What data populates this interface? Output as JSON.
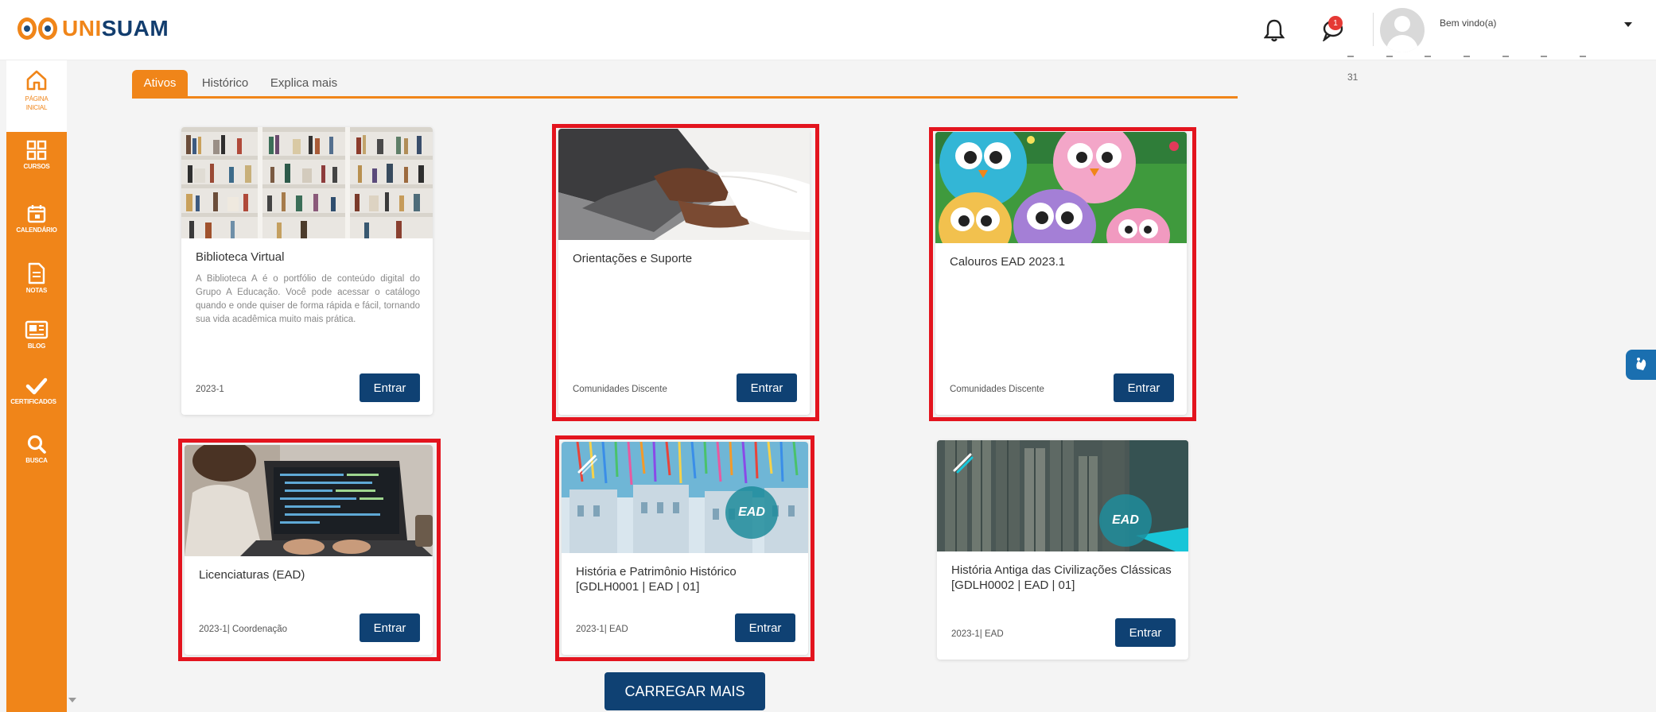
{
  "header": {
    "logo_prefix": "UNI",
    "logo_suffix": "SUAM",
    "notification_count": "1",
    "welcome_text": "Bem vindo(a)"
  },
  "sidebar": {
    "items": [
      {
        "label": "PÁGINA INICIAL",
        "icon": "home-icon"
      },
      {
        "label": "CURSOS",
        "icon": "grid-icon"
      },
      {
        "label": "CALENDÁRIO",
        "icon": "calendar-icon"
      },
      {
        "label": "NOTAS",
        "icon": "document-icon"
      },
      {
        "label": "BLOG",
        "icon": "newspaper-icon"
      },
      {
        "label": "CERTIFICADOS",
        "icon": "check-icon"
      },
      {
        "label": "BUSCA",
        "icon": "search-icon"
      }
    ]
  },
  "tabs": [
    {
      "label": "Ativos",
      "active": true
    },
    {
      "label": "Histórico",
      "active": false
    },
    {
      "label": "Explica mais",
      "active": false
    }
  ],
  "cards": [
    {
      "title": "Biblioteca Virtual",
      "description": "A Biblioteca A é o portfólio de conteúdo digital do Grupo A Educação. Você pode acessar o catálogo quando e onde quiser de forma rápida e fácil, tornando sua vida acadêmica muito mais prática.",
      "meta": "2023-1",
      "button": "Entrar",
      "image": "bookshelf",
      "highlighted": false
    },
    {
      "title": "Orientações e Suporte",
      "description": "",
      "meta": "Comunidades Discente",
      "button": "Entrar",
      "image": "laptop-typing",
      "highlighted": true
    },
    {
      "title": "Calouros EAD 2023.1",
      "description": "",
      "meta": "Comunidades Discente",
      "button": "Entrar",
      "image": "cartoon-owls",
      "highlighted": true
    },
    {
      "title": "Licenciaturas (EAD)",
      "description": "",
      "meta": "2023-1| Coordenação",
      "button": "Entrar",
      "image": "laptop-code",
      "highlighted": true
    },
    {
      "title": "História e Patrimônio Histórico [GDLH0001 | EAD | 01]",
      "description": "",
      "meta": "2023-1| EAD",
      "button": "Entrar",
      "image": "colonial-ribbons",
      "badge": "EAD",
      "highlighted": true
    },
    {
      "title": "História Antiga das Civilizações Clássicas [GDLH0002 | EAD | 01]",
      "description": "",
      "meta": "2023-1| EAD",
      "button": "Entrar",
      "image": "ancient-ruins",
      "badge": "EAD",
      "highlighted": false
    }
  ],
  "load_more": "CARREGAR MAIS",
  "calendar": {
    "visible_day": "31"
  },
  "colors": {
    "brand_orange": "#f08519",
    "brand_navy": "#0f4173",
    "highlight_red": "#e3141e"
  }
}
